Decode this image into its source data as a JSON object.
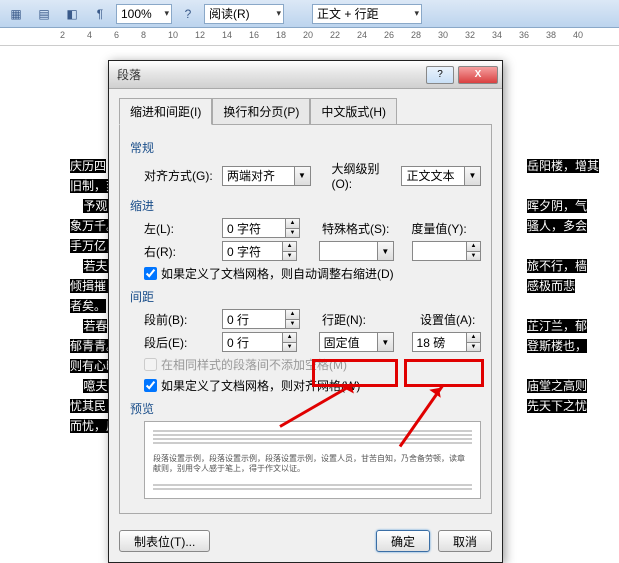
{
  "toolbar": {
    "zoom": "100%",
    "reading": "阅读(R)",
    "style": "正文 + 行距"
  },
  "ruler": {
    "marks": [
      "2",
      "4",
      "6",
      "8",
      "10",
      "12",
      "14",
      "16",
      "18",
      "20",
      "22",
      "24",
      "26",
      "28",
      "30",
      "32",
      "34",
      "36",
      "38",
      "40"
    ]
  },
  "doc_lines": [
    "庆历四",
    "旧制，刻居",
    "予观夫",
    "象万千。此",
    "手万亿，贸物",
    "若夫霪",
    "倾揖摧；浮",
    "者矣。",
    "若春",
    "郁青青。而",
    "则有心旷神",
    "噫夫！",
    "忧其民；处",
    "而忧，后天"
  ],
  "doc_right": [
    "岳阳楼，增其",
    "",
    "晖夕阴，气",
    "骚人，多会",
    "",
    "旅不行，樯",
    "感极而悲",
    "",
    "芷汀兰，郁",
    "登斯楼也，",
    "",
    "庙堂之高则",
    "先天下之忧"
  ],
  "dialog": {
    "title": "段落",
    "tabs": [
      "缩进和间距(I)",
      "换行和分页(P)",
      "中文版式(H)"
    ],
    "general": {
      "label": "常规",
      "align_label": "对齐方式(G):",
      "align_value": "两端对齐",
      "outline_label": "大纲级别(O):",
      "outline_value": "正文文本"
    },
    "indent": {
      "label": "缩进",
      "left_label": "左(L):",
      "left_value": "0 字符",
      "right_label": "右(R):",
      "right_value": "0 字符",
      "special_label": "特殊格式(S):",
      "metric_label": "度量值(Y):",
      "chk1": "如果定义了文档网格，则自动调整右缩进(D)"
    },
    "spacing": {
      "label": "间距",
      "before_label": "段前(B):",
      "before_value": "0 行",
      "after_label": "段后(E):",
      "after_value": "0 行",
      "linespacing_label": "行距(N):",
      "linespacing_value": "固定值",
      "setat_label": "设置值(A):",
      "setat_value": "18 磅",
      "chk2": "在相同样式的段落间不添加空格(M)",
      "chk3": "如果定义了文档网格，则对齐网格(W)"
    },
    "preview": {
      "label": "预览",
      "sample": "段落设置示例，段落设置示例，段落设置示例，设置人员，甘苦自知，乃舍备劳顿，读章献则，别用令人感于笔上，得于作文以证。"
    },
    "buttons": {
      "tabstops": "制表位(T)...",
      "ok": "确定",
      "cancel": "取消"
    }
  }
}
